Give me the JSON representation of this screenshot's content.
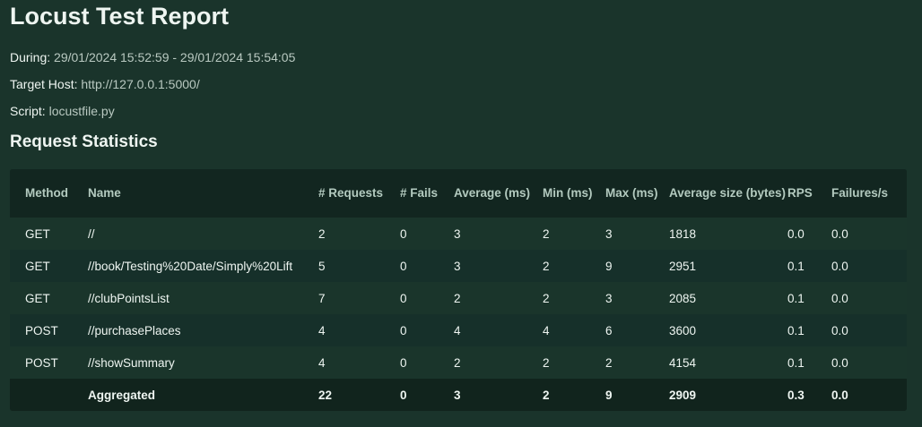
{
  "title": "Locust Test Report",
  "info": [
    {
      "label": "During:",
      "value": "29/01/2024 15:52:59 - 29/01/2024 15:54:05"
    },
    {
      "label": "Target Host:",
      "value": "http://127.0.0.1:5000/"
    },
    {
      "label": "Script:",
      "value": "locustfile.py"
    }
  ],
  "section_title": "Request Statistics",
  "table": {
    "headers": [
      "Method",
      "Name",
      "# Requests",
      "# Fails",
      "Average (ms)",
      "Min (ms)",
      "Max (ms)",
      "Average size (bytes)",
      "RPS",
      "Failures/s"
    ],
    "rows": [
      [
        "GET",
        "//",
        "2",
        "0",
        "3",
        "2",
        "3",
        "1818",
        "0.0",
        "0.0"
      ],
      [
        "GET",
        "//book/Testing%20Date/Simply%20Lift",
        "5",
        "0",
        "3",
        "2",
        "9",
        "2951",
        "0.1",
        "0.0"
      ],
      [
        "GET",
        "//clubPointsList",
        "7",
        "0",
        "2",
        "2",
        "3",
        "2085",
        "0.1",
        "0.0"
      ],
      [
        "POST",
        "//purchasePlaces",
        "4",
        "0",
        "4",
        "4",
        "6",
        "3600",
        "0.1",
        "0.0"
      ],
      [
        "POST",
        "//showSummary",
        "4",
        "0",
        "2",
        "2",
        "2",
        "4154",
        "0.1",
        "0.0"
      ]
    ],
    "aggregated": [
      "",
      "Aggregated",
      "22",
      "0",
      "3",
      "2",
      "9",
      "2909",
      "0.3",
      "0.0"
    ]
  }
}
